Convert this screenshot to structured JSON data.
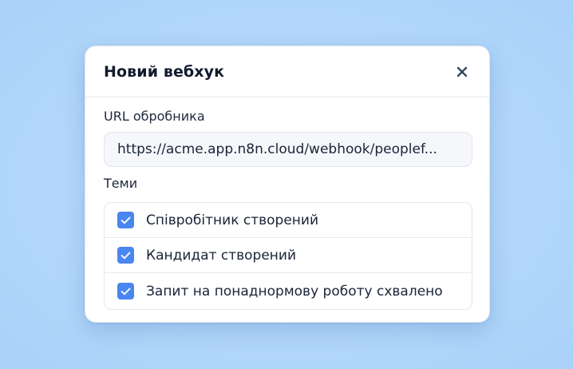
{
  "dialog": {
    "title": "Новий вебхук",
    "close_icon": "close-icon"
  },
  "url_field": {
    "label": "URL обробника",
    "value": "https://acme.app.n8n.cloud/webhook/peoplef..."
  },
  "topics": {
    "label": "Теми",
    "items": [
      {
        "label": "Співробітник створений",
        "checked": true
      },
      {
        "label": "Кандидат створений",
        "checked": true
      },
      {
        "label": "Запит на понаднормову роботу схвалено",
        "checked": true
      }
    ]
  },
  "colors": {
    "accent": "#4a86f0",
    "background": "#b3d7fa",
    "title": "#111b2e"
  }
}
